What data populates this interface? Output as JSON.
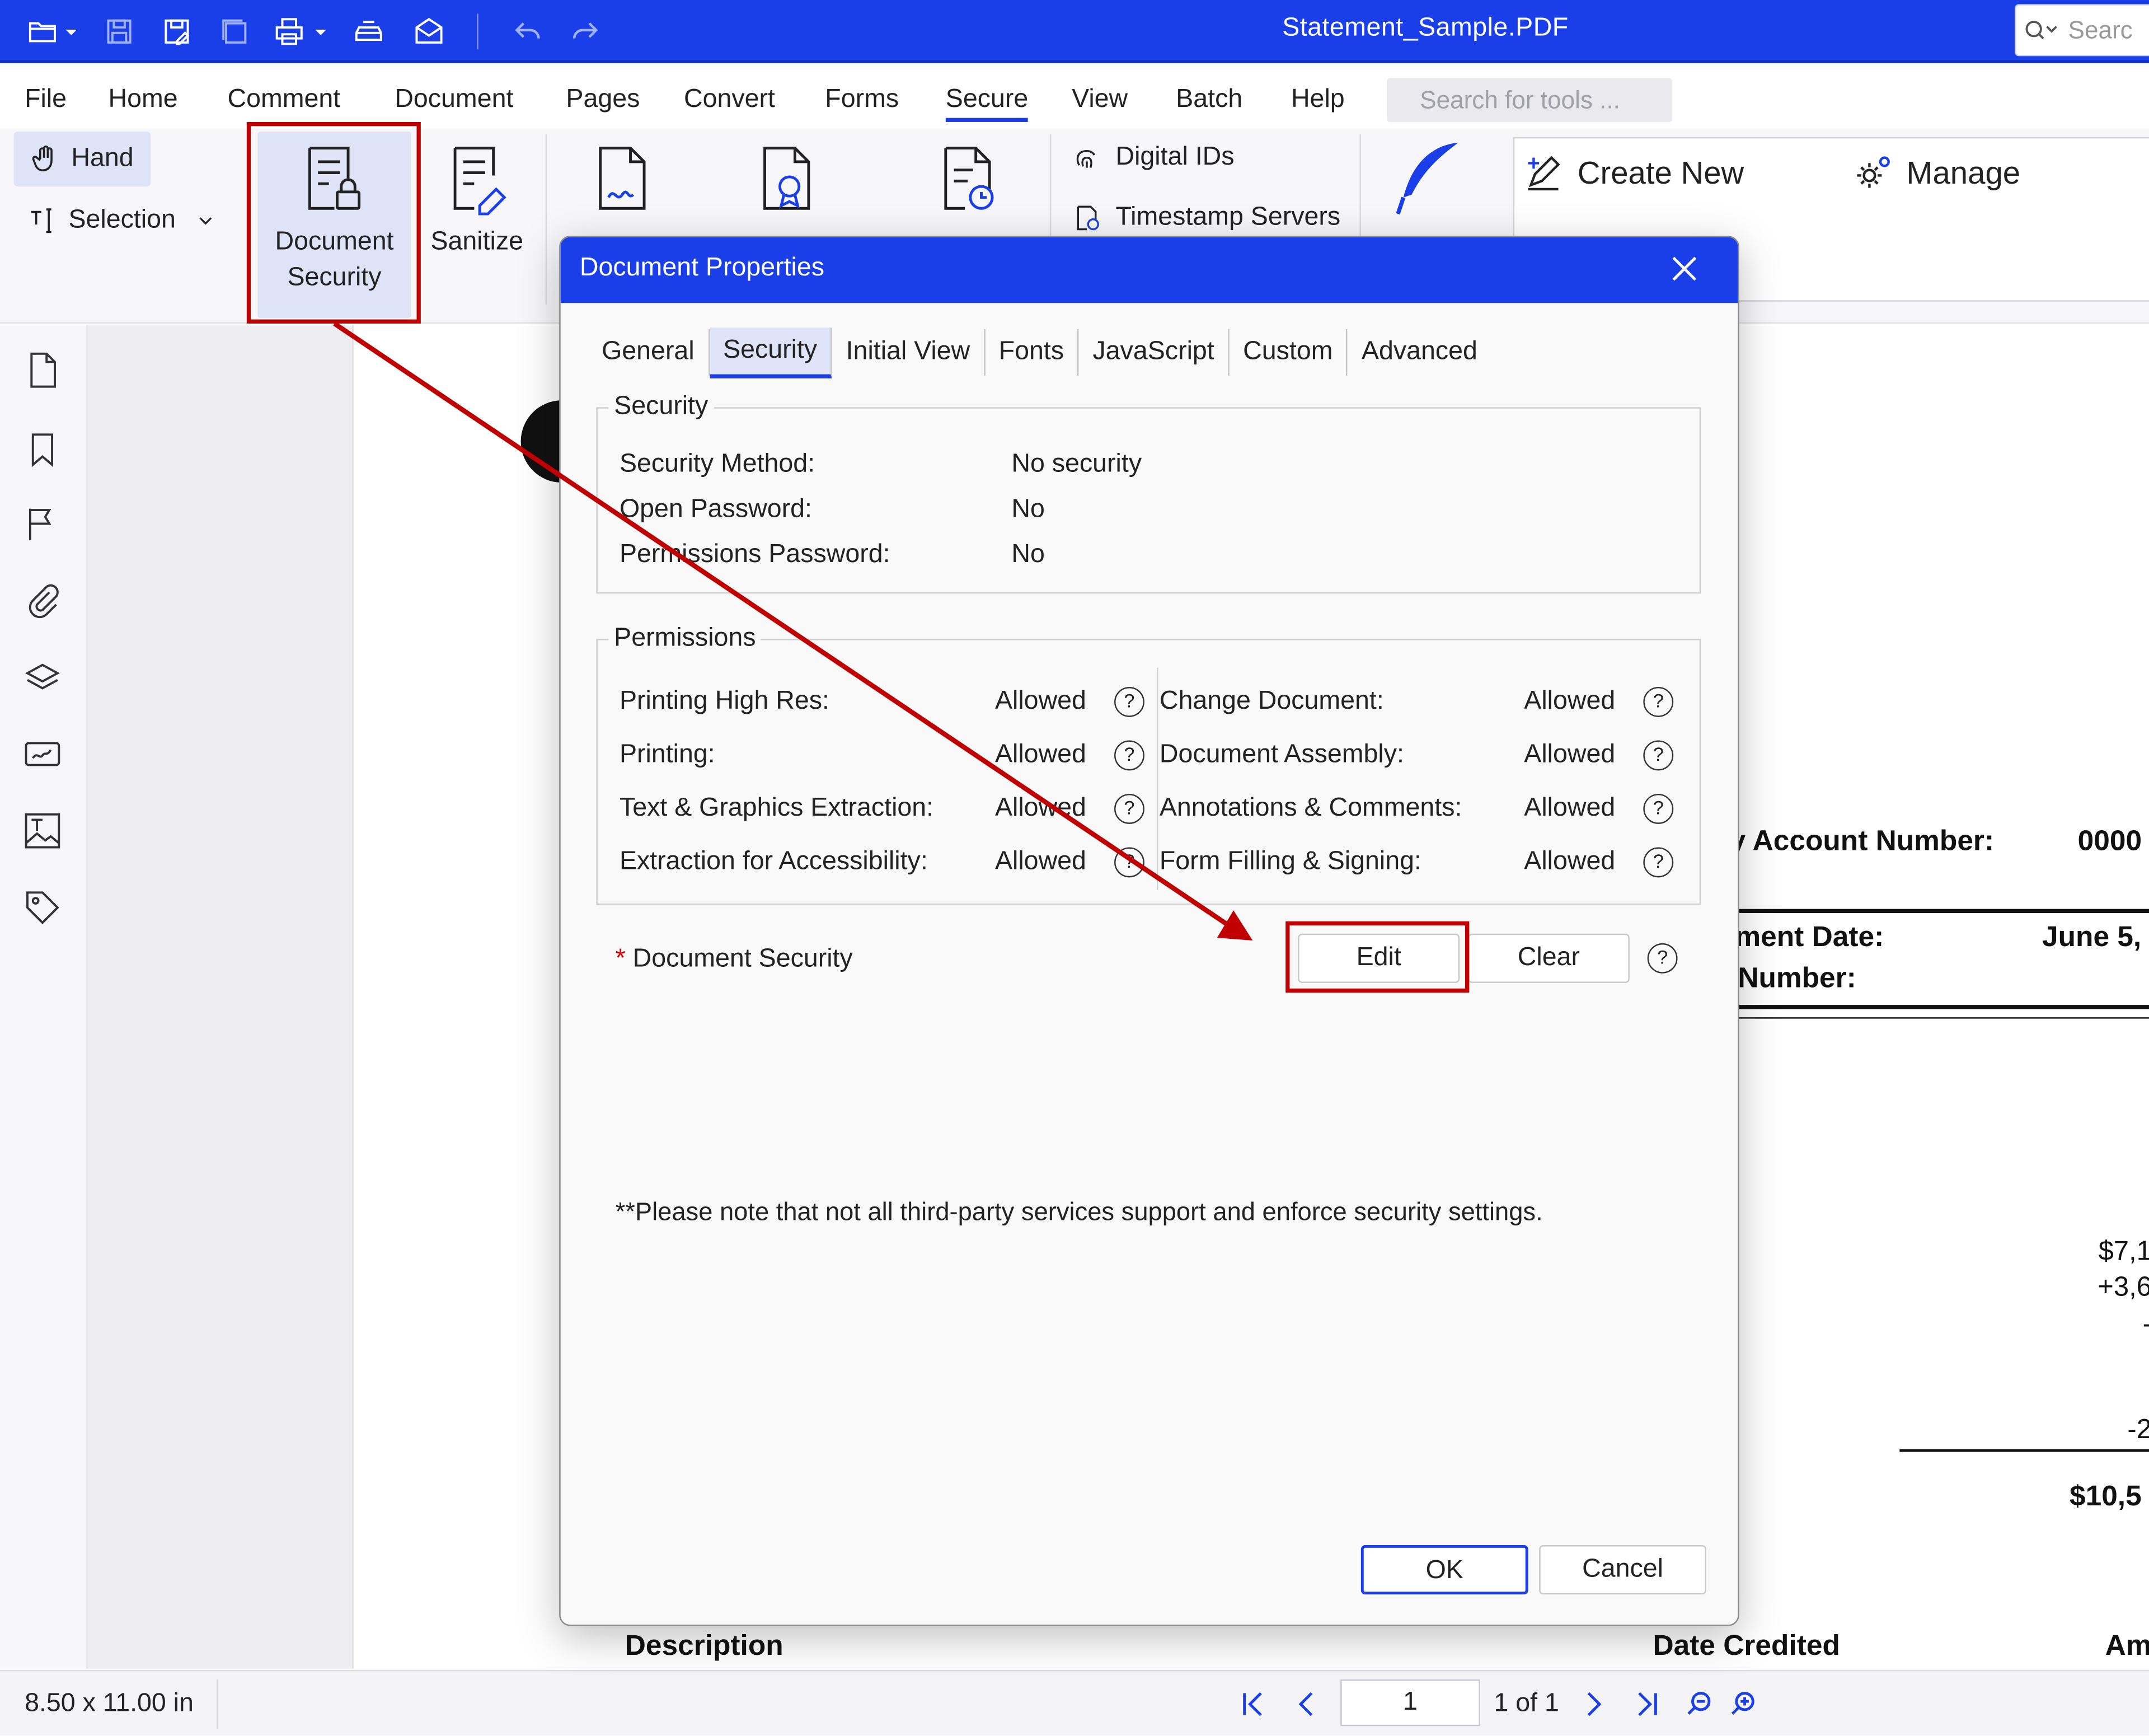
{
  "window": {
    "title": "Statement_Sample.PDF",
    "search_placeholder": "Searc"
  },
  "menu": {
    "items": [
      "File",
      "Home",
      "Comment",
      "Document",
      "Pages",
      "Convert",
      "Forms",
      "Secure",
      "View",
      "Batch",
      "Help"
    ],
    "active": "Secure",
    "tool_search_placeholder": "Search for tools ..."
  },
  "ribbon": {
    "hand_label": "Hand",
    "selection_label": "Selection",
    "document_security_label_1": "Document",
    "document_security_label_2": "Security",
    "sanitize_label": "Sanitize",
    "digital_ids_label": "Digital IDs",
    "timestamp_servers_label": "Timestamp Servers",
    "create_new_label": "Create New",
    "manage_label": "Manage"
  },
  "document_page": {
    "account_number_label": "y Account Number:",
    "account_number_value": "0000",
    "statement_date_label": "ment Date:",
    "statement_date_value": "June 5,",
    "number_label": "Number:",
    "amount_1": "$7,1",
    "amount_2": "+3,6",
    "amount_3": "-",
    "amount_4": "-2",
    "total": "$10,5",
    "col_description": "Description",
    "col_date_credited": "Date Credited",
    "col_amount": "Am"
  },
  "status_bar": {
    "page_size": "8.50 x 11.00 in",
    "current_page": "1",
    "page_of": "1 of 1"
  },
  "dialog": {
    "title": "Document Properties",
    "tabs": [
      "General",
      "Security",
      "Initial View",
      "Fonts",
      "JavaScript",
      "Custom",
      "Advanced"
    ],
    "active_tab": "Security",
    "security_group": {
      "legend": "Security",
      "rows": [
        {
          "label": "Security Method:",
          "value": "No security"
        },
        {
          "label": "Open Password:",
          "value": "No"
        },
        {
          "label": "Permissions Password:",
          "value": "No"
        }
      ]
    },
    "permissions_group": {
      "legend": "Permissions",
      "left": [
        {
          "label": "Printing High Res:",
          "value": "Allowed"
        },
        {
          "label": "Printing:",
          "value": "Allowed"
        },
        {
          "label": "Text & Graphics Extraction:",
          "value": "Allowed"
        },
        {
          "label": "Extraction for Accessibility:",
          "value": "Allowed"
        }
      ],
      "right": [
        {
          "label": "Change Document:",
          "value": "Allowed"
        },
        {
          "label": "Document Assembly:",
          "value": "Allowed"
        },
        {
          "label": "Annotations & Comments:",
          "value": "Allowed"
        },
        {
          "label": "Form Filling & Signing:",
          "value": "Allowed"
        }
      ]
    },
    "document_security_label": "Document Security",
    "required_mark": "*",
    "edit_label": "Edit",
    "clear_label": "Clear",
    "help_glyph": "?",
    "note": "**Please note that not all third-party services support and enforce security settings.",
    "ok_label": "OK",
    "cancel_label": "Cancel"
  },
  "colors": {
    "accent": "#1a3fe8",
    "highlight": "#c00000",
    "ribbon_active_bg": "#dfe3f7"
  }
}
